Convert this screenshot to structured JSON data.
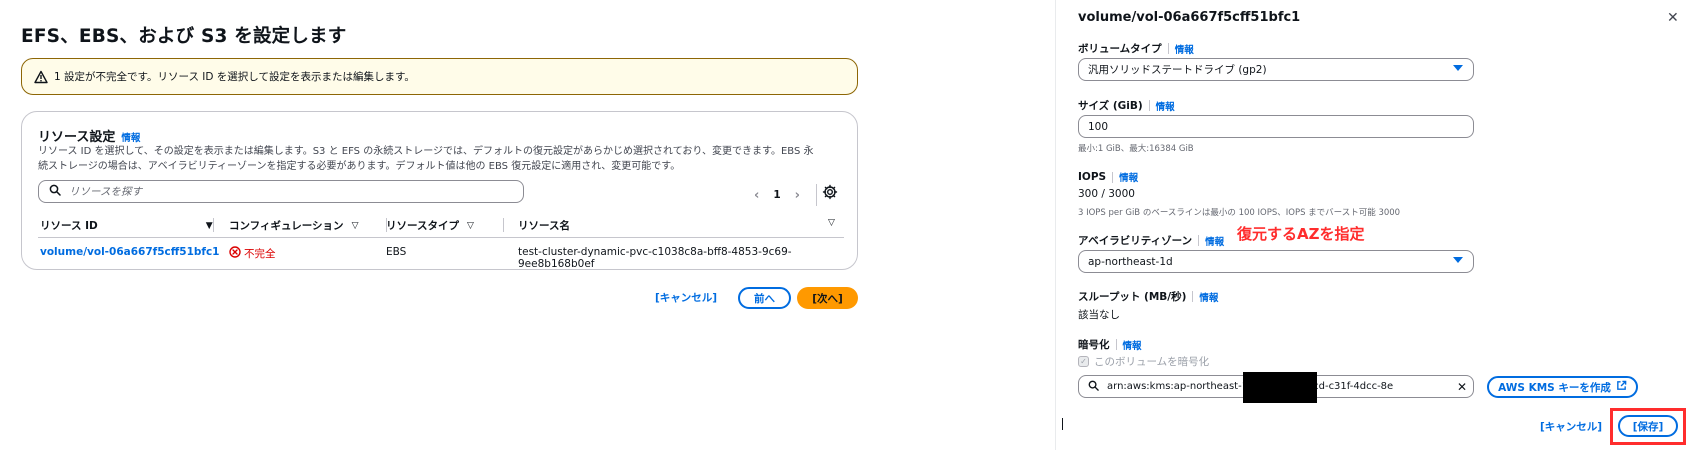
{
  "page": {
    "title": "EFS、EBS、および S3 を設定します",
    "alert": "1 設定が不完全です。リソース ID を選択して設定を表示または編集します。"
  },
  "resource_settings": {
    "title": "リソース設定",
    "info": "情報",
    "description_line1": "リソース ID を選択して、その設定を表示または編集します。S3 と EFS の永続ストレージでは、デフォルトの復元設定があらかじめ選択されており、変更できます。EBS 永",
    "description_line2": "続ストレージの場合は、アベイラビリティーゾーンを指定する必要があります。デフォルト値は他の EBS 復元設定に適用され、変更可能です。",
    "search_placeholder": "リソースを探す",
    "page_number": "1",
    "columns": [
      "リソース ID",
      "コンフィギュレーション",
      "リソースタイプ",
      "リソース名"
    ],
    "rows": [
      {
        "id": "volume/vol-06a667f5cff51bfc1",
        "config": "不完全",
        "type": "EBS",
        "name": "test-cluster-dynamic-pvc-c1038c8a-bff8-4853-9c69-9ee8b168b0ef"
      }
    ]
  },
  "footer": {
    "cancel": "[キャンセル]",
    "prev": "前へ",
    "next": "[次へ]"
  },
  "panel": {
    "title": "volume/vol-06a667f5cff51bfc1",
    "info": "情報",
    "volume_type_label": "ボリュームタイプ",
    "volume_type_value": "汎用ソリッドステートドライブ (gp2)",
    "size_label": "サイズ (GiB)",
    "size_value": "100",
    "size_hint": "最小:1 GiB、最大:16384 GiB",
    "iops_label": "IOPS",
    "iops_value": "300 / 3000",
    "iops_hint": "3 IOPS per GiB のベースラインは最小の 100 IOPS、IOPS までバースト可能 3000",
    "az_label": "アベイラビリティゾーン",
    "az_value": "ap-northeast-1d",
    "annotation": "復元するAZを指定",
    "throughput_label": "スループット (MB/秒)",
    "throughput_value": "該当なし",
    "encryption_label": "暗号化",
    "encrypt_checkbox": "このボリュームを暗号化",
    "kms_value": "arn:aws:kms:ap-northeast-1:            :key/c0ef72cd-c31f-4dcc-8e",
    "kms_button": "AWS KMS キーを作成",
    "cancel": "[キャンセル]",
    "save": "[保存]"
  }
}
